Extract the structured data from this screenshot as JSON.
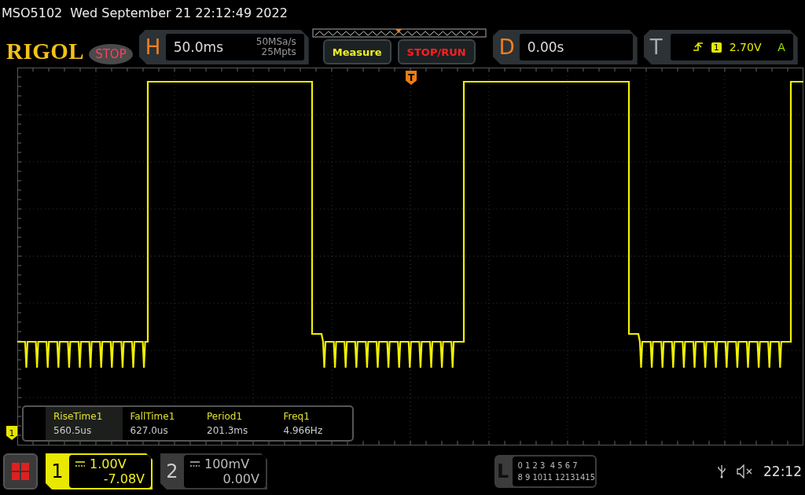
{
  "title_bar": {
    "model": "MSO5102",
    "datetime": "Wed September 21 22:12:49 2022"
  },
  "toolbar": {
    "logo": "RIGOL",
    "run_state": "STOP",
    "horizontal": {
      "label": "H",
      "timebase": "50.0ms",
      "sample_rate": "50MSa/s",
      "memory_depth": "25Mpts"
    },
    "buttons": [
      {
        "label": "Measure",
        "kind": "menu"
      },
      {
        "label": "STOP/RUN",
        "kind": "run"
      }
    ],
    "delay": {
      "label": "D",
      "value": "0.00s"
    },
    "trigger": {
      "label": "T",
      "source": "1",
      "level": "2.70V",
      "mode": "A"
    }
  },
  "screen": {
    "trigger_marker": "T",
    "channel_marker": "1",
    "measurements": [
      {
        "name": "RiseTime1",
        "value": "560.5us",
        "selected": true
      },
      {
        "name": "FallTime1",
        "value": "627.0us",
        "selected": false
      },
      {
        "name": "Period1",
        "value": "201.3ms",
        "selected": false
      },
      {
        "name": "Freq1",
        "value": "4.966Hz",
        "selected": false
      }
    ]
  },
  "channels": [
    {
      "number": "1",
      "scale": "1.00V",
      "offset": "-7.08V",
      "on": true
    },
    {
      "number": "2",
      "scale": "100mV",
      "offset": "0.00V",
      "on": false
    }
  ],
  "logic": {
    "label": "L",
    "row_1": "0 1 2 3  4 5 6 7",
    "row_2": "8 9 1011 12131415"
  },
  "status": {
    "time": "22:12"
  }
}
